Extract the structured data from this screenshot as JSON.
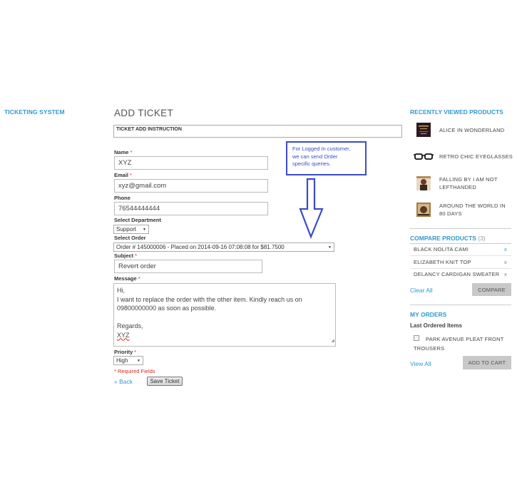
{
  "left_nav": {
    "title": "TICKETING SYSTEM"
  },
  "form": {
    "page_title": "ADD TICKET",
    "instruction_title": "TICKET ADD INSTRUCTION",
    "name": {
      "label": "Name",
      "required": "*",
      "value": "XYZ"
    },
    "email": {
      "label": "Email",
      "required": "*",
      "value": "xyz@gmail.com"
    },
    "phone": {
      "label": "Phone",
      "value": "76544444444"
    },
    "department": {
      "label": "Select Department",
      "value": "Support"
    },
    "order": {
      "label": "Select Order",
      "value": "Order # 145000006 - Placed on 2014-09-16 07:08:08 for $81.7500"
    },
    "subject": {
      "label": "Subject",
      "required": "*",
      "value": "Revert order"
    },
    "message": {
      "label": "Message",
      "required": "*",
      "lines": [
        "Hi,",
        "I want to replace the order with the other item. Kindly reach us on",
        "09800000000 as soon as possible.",
        "",
        "Regards,",
        "XYZ"
      ]
    },
    "priority": {
      "label": "Priority",
      "required": "*",
      "value": "High"
    },
    "required_note": "* Required Fields",
    "back_label": "« Back",
    "save_label": "Save Ticket"
  },
  "annotation": {
    "lines": [
      "For Logged In customer,",
      "we can send Order",
      "specific queries."
    ],
    "color": "#3b4bc8"
  },
  "sidebar": {
    "recently_viewed": {
      "title": "RECENTLY VIEWED PRODUCTS",
      "items": [
        {
          "name_lines": [
            "ALICE IN WONDERLAND"
          ],
          "icon": "book-cover-icon"
        },
        {
          "name_lines": [
            "RETRO CHIC EYEGLASSES"
          ],
          "icon": "eyeglasses-icon"
        },
        {
          "name_lines": [
            "FALLING BY I AM NOT",
            "LEFTHANDED"
          ],
          "icon": "album-cover-icon"
        },
        {
          "name_lines": [
            "AROUND THE WORLD IN",
            "80 DAYS"
          ],
          "icon": "book-cover-icon"
        }
      ]
    },
    "compare": {
      "title": "COMPARE PRODUCTS",
      "count": "(3)",
      "items": [
        "BLACK NOLITA CAMI",
        "ELIZABETH KNIT TOP",
        "DELANCY CARDIGAN SWEATER"
      ],
      "remove_label": "x",
      "clear_all": "Clear All",
      "compare_button": "COMPARE"
    },
    "my_orders": {
      "title": "MY ORDERS",
      "subtitle": "Last Ordered Items",
      "item_lines": [
        "PARK AVENUE PLEAT FRONT",
        "TROUSERS"
      ],
      "view_all": "View All",
      "add_to_cart": "ADD TO CART"
    }
  },
  "colors": {
    "accent": "#3399cc",
    "required": "#d9261c",
    "annotation": "#3b4bc8"
  }
}
